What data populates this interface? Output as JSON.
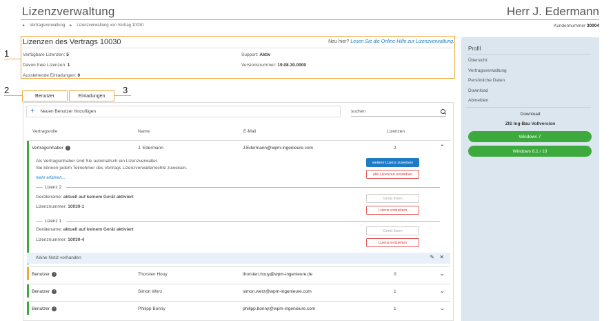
{
  "header": {
    "title": "Lizenzverwaltung",
    "user": "Herr J. Edermann",
    "breadcrumb": [
      "Vertragsverwaltung",
      "Lizenzverwaltung von Vertrag 10030"
    ],
    "customer_label": "Kundennummer",
    "customer_number": "30004"
  },
  "annotations": [
    "1",
    "2",
    "3"
  ],
  "license": {
    "title": "Lizenzen des Vertrags 10030",
    "help_prefix": "Neu hier?",
    "help_link": "Lesen Sie die Online-Hilfe zur Lizenzverwaltung.",
    "available_label": "Verfügbare Lizenzen:",
    "available_value": "5",
    "free_label": "Davon freie Lizenzen:",
    "free_value": "1",
    "pending_label": "Ausstehende Einladungen:",
    "pending_value": "0",
    "support_label": "Support:",
    "support_value": "Aktiv",
    "version_label": "Versionsnummer:",
    "version_value": "19.08.30.0000"
  },
  "tabs": {
    "users": "Benutzer",
    "invites": "Einladungen"
  },
  "toolbar": {
    "add_user": "Neuen Benutzer hinzufügen",
    "search_placeholder": "suchen"
  },
  "columns": {
    "role": "Vertragsrolle",
    "name": "Name",
    "email": "E-Mail",
    "licenses": "Lizenzen"
  },
  "owner": {
    "role": "Vertragsinhaber",
    "name": "J. Edermann",
    "email": "J.Edermann@wpm-ingenieure.com",
    "licenses": "2",
    "text1": "Als Vertragsinhaber sind Sie automatisch ein Lizenzverwalter.",
    "text2": "Sie können jedem Teilnehmer des Vertrags Lizenzverwalterrechte zuweisen.",
    "more": "mehr erfahren...",
    "btn_assign": "weitere Lizenz zuweisen",
    "btn_revoke_all": "alle Lizenzen entziehen",
    "license_items": [
      {
        "heading": "Lizenz 2",
        "device_label": "Gerätename:",
        "device_value": "aktuell auf keinem Gerät aktiviert",
        "number_label": "Lizenznummer:",
        "number_value": "10030-1",
        "btn_release": "Gerät lösen",
        "btn_revoke": "Lizenz entziehen"
      },
      {
        "heading": "Lizenz 1",
        "device_label": "Gerätename:",
        "device_value": "aktuell auf keinem Gerät aktiviert",
        "number_label": "Lizenznummer:",
        "number_value": "10030-4",
        "btn_release": "Gerät lösen",
        "btn_revoke": "Lizenz entziehen"
      }
    ],
    "note": "Keine Notiz vorhanden"
  },
  "users": [
    {
      "role": "Benutzer",
      "name": "Thorsten Houy",
      "email": "thorsten.houy@wpm-ingenieure.de",
      "licenses": "0",
      "color": "#f0a93c"
    },
    {
      "role": "Benutzer",
      "name": "Simon Werz",
      "email": "simon.werz@wpm-ingenieure.com",
      "licenses": "1",
      "color": "#3daa3d"
    },
    {
      "role": "Benutzer",
      "name": "Philipp Bonny",
      "email": "philipp.bonny@wpm-ingenieure.com",
      "licenses": "1",
      "color": "#3daa3d"
    }
  ],
  "sidebar": {
    "title": "Profil",
    "items": [
      "Übersicht",
      "Vertragsverwaltung",
      "Persönliche Daten",
      "Download",
      "Abmelden"
    ],
    "download_title": "Download",
    "product": "ZIS Ing-Bau Vollversion",
    "buttons": [
      "Windows 7",
      "Windows 8.1 / 10"
    ]
  },
  "colors": {
    "accent": "#f0a93c",
    "link": "#1f7cc4",
    "green": "#3daa3d",
    "sidebar": "#dce6ef"
  }
}
